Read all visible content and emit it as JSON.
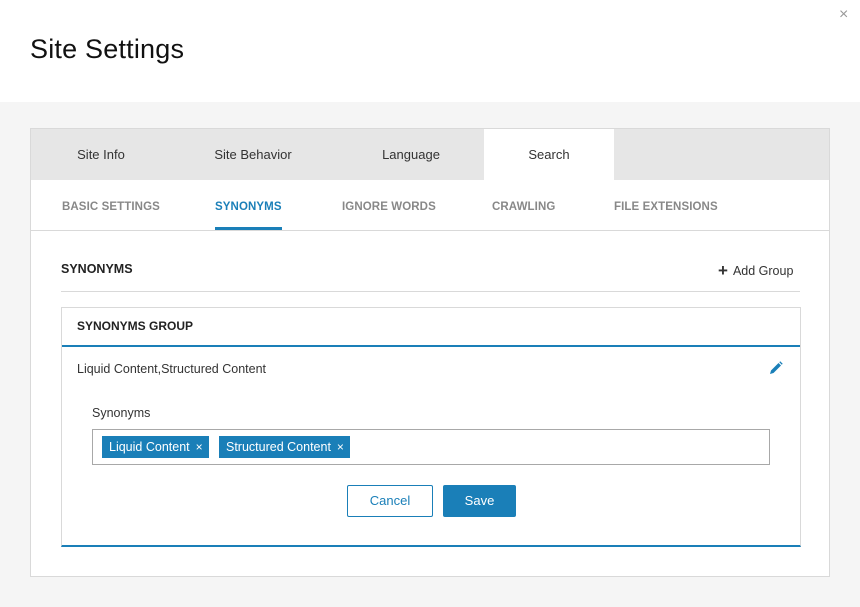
{
  "dialog": {
    "title": "Site Settings",
    "close_icon": "×"
  },
  "tabs": [
    {
      "label": "Site Info",
      "active": false
    },
    {
      "label": "Site Behavior",
      "active": false
    },
    {
      "label": "Language",
      "active": false
    },
    {
      "label": "Search",
      "active": true
    }
  ],
  "subtabs": [
    {
      "label": "BASIC SETTINGS",
      "active": false
    },
    {
      "label": "SYNONYMS",
      "active": true
    },
    {
      "label": "IGNORE WORDS",
      "active": false
    },
    {
      "label": "CRAWLING",
      "active": false
    },
    {
      "label": "FILE EXTENSIONS",
      "active": false
    }
  ],
  "section": {
    "title": "SYNONYMS",
    "add_icon": "+",
    "add_label": "Add Group"
  },
  "group": {
    "header": "SYNONYMS GROUP",
    "summary": "Liquid Content,Structured Content",
    "edit_icon": "pencil-icon",
    "synonyms_label": "Synonyms",
    "tags": [
      {
        "label": "Liquid Content",
        "remove": "×"
      },
      {
        "label": "Structured Content",
        "remove": "×"
      }
    ],
    "cancel_label": "Cancel",
    "save_label": "Save"
  },
  "colors": {
    "accent": "#1a7fb8",
    "tab_bar": "#e6e6e6",
    "page_bg": "#f5f5f5"
  }
}
